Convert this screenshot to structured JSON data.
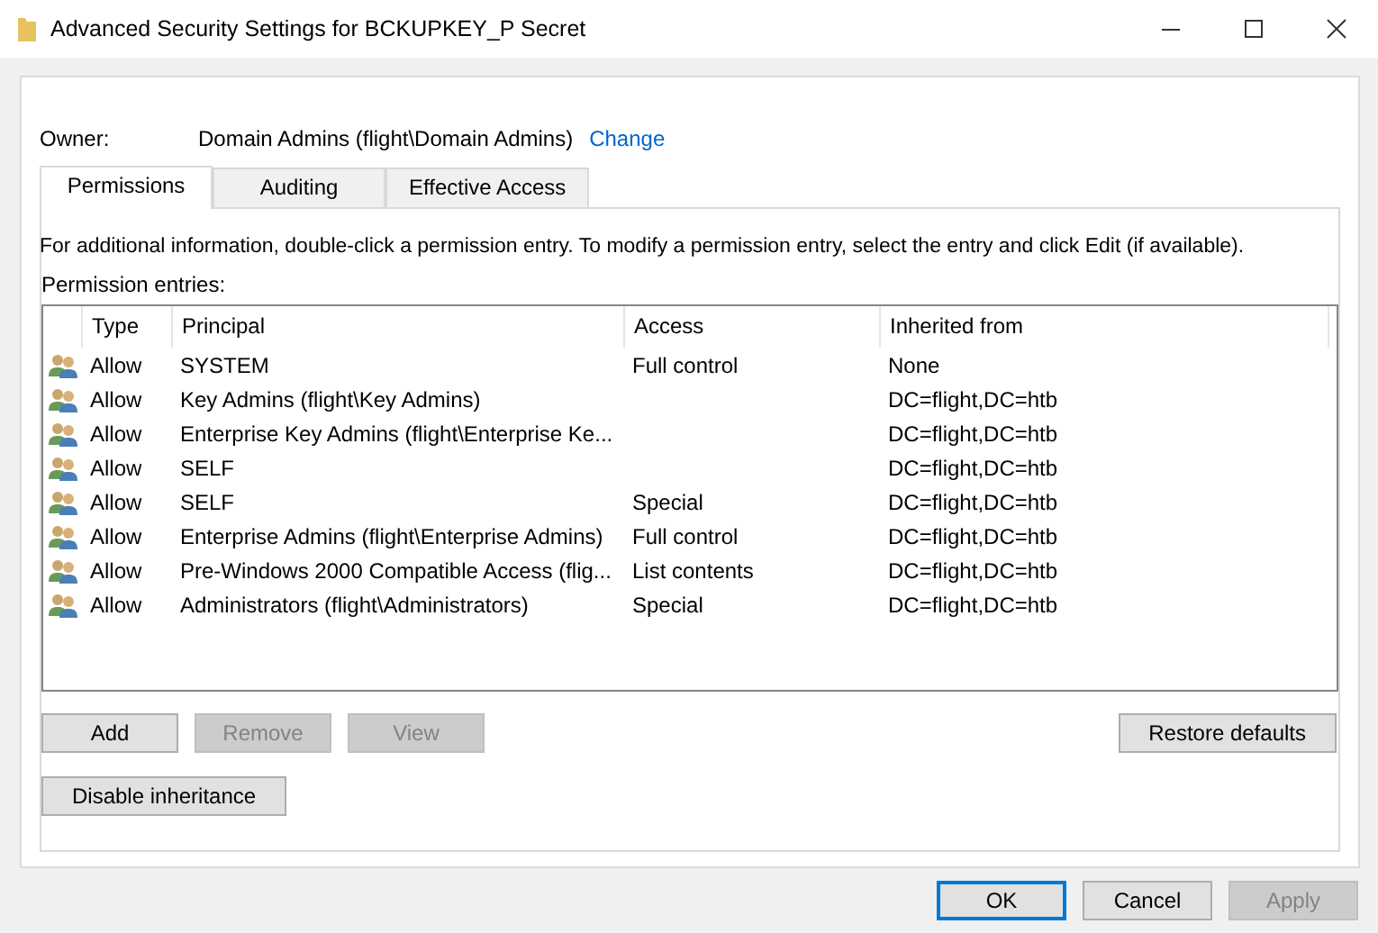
{
  "window": {
    "title": "Advanced Security Settings for BCKUPKEY_P Secret"
  },
  "owner": {
    "label": "Owner:",
    "value": "Domain Admins (flight\\Domain Admins)",
    "link": "Change"
  },
  "tabs": [
    {
      "label": "Permissions",
      "selected": true
    },
    {
      "label": "Auditing",
      "selected": false
    },
    {
      "label": "Effective Access",
      "selected": false
    }
  ],
  "info_text": "For additional information, double-click a permission entry. To modify a permission entry, select the entry and click Edit (if available).",
  "entries_label": "Permission entries:",
  "table": {
    "columns": [
      "Type",
      "Principal",
      "Access",
      "Inherited from"
    ],
    "rows": [
      {
        "type": "Allow",
        "principal": "SYSTEM",
        "access": "Full control",
        "inherited_from": "None"
      },
      {
        "type": "Allow",
        "principal": "Key Admins (flight\\Key Admins)",
        "access": "",
        "inherited_from": "DC=flight,DC=htb"
      },
      {
        "type": "Allow",
        "principal": "Enterprise Key Admins (flight\\Enterprise Ke...",
        "access": "",
        "inherited_from": "DC=flight,DC=htb"
      },
      {
        "type": "Allow",
        "principal": "SELF",
        "access": "",
        "inherited_from": "DC=flight,DC=htb"
      },
      {
        "type": "Allow",
        "principal": "SELF",
        "access": "Special",
        "inherited_from": "DC=flight,DC=htb"
      },
      {
        "type": "Allow",
        "principal": "Enterprise Admins (flight\\Enterprise Admins)",
        "access": "Full control",
        "inherited_from": "DC=flight,DC=htb"
      },
      {
        "type": "Allow",
        "principal": "Pre-Windows 2000 Compatible Access (flig...",
        "access": "List contents",
        "inherited_from": "DC=flight,DC=htb"
      },
      {
        "type": "Allow",
        "principal": "Administrators (flight\\Administrators)",
        "access": "Special",
        "inherited_from": "DC=flight,DC=htb"
      }
    ]
  },
  "entry_buttons": [
    {
      "label": "Add",
      "disabled": false
    },
    {
      "label": "Remove",
      "disabled": true
    },
    {
      "label": "View",
      "disabled": true
    }
  ],
  "restore_button": {
    "label": "Restore defaults",
    "disabled": false
  },
  "inheritance_button": {
    "label": "Disable inheritance",
    "disabled": false
  },
  "dialog_buttons": [
    {
      "label": "OK",
      "disabled": false,
      "default": true
    },
    {
      "label": "Cancel",
      "disabled": false,
      "default": false
    },
    {
      "label": "Apply",
      "disabled": true,
      "default": false
    }
  ]
}
